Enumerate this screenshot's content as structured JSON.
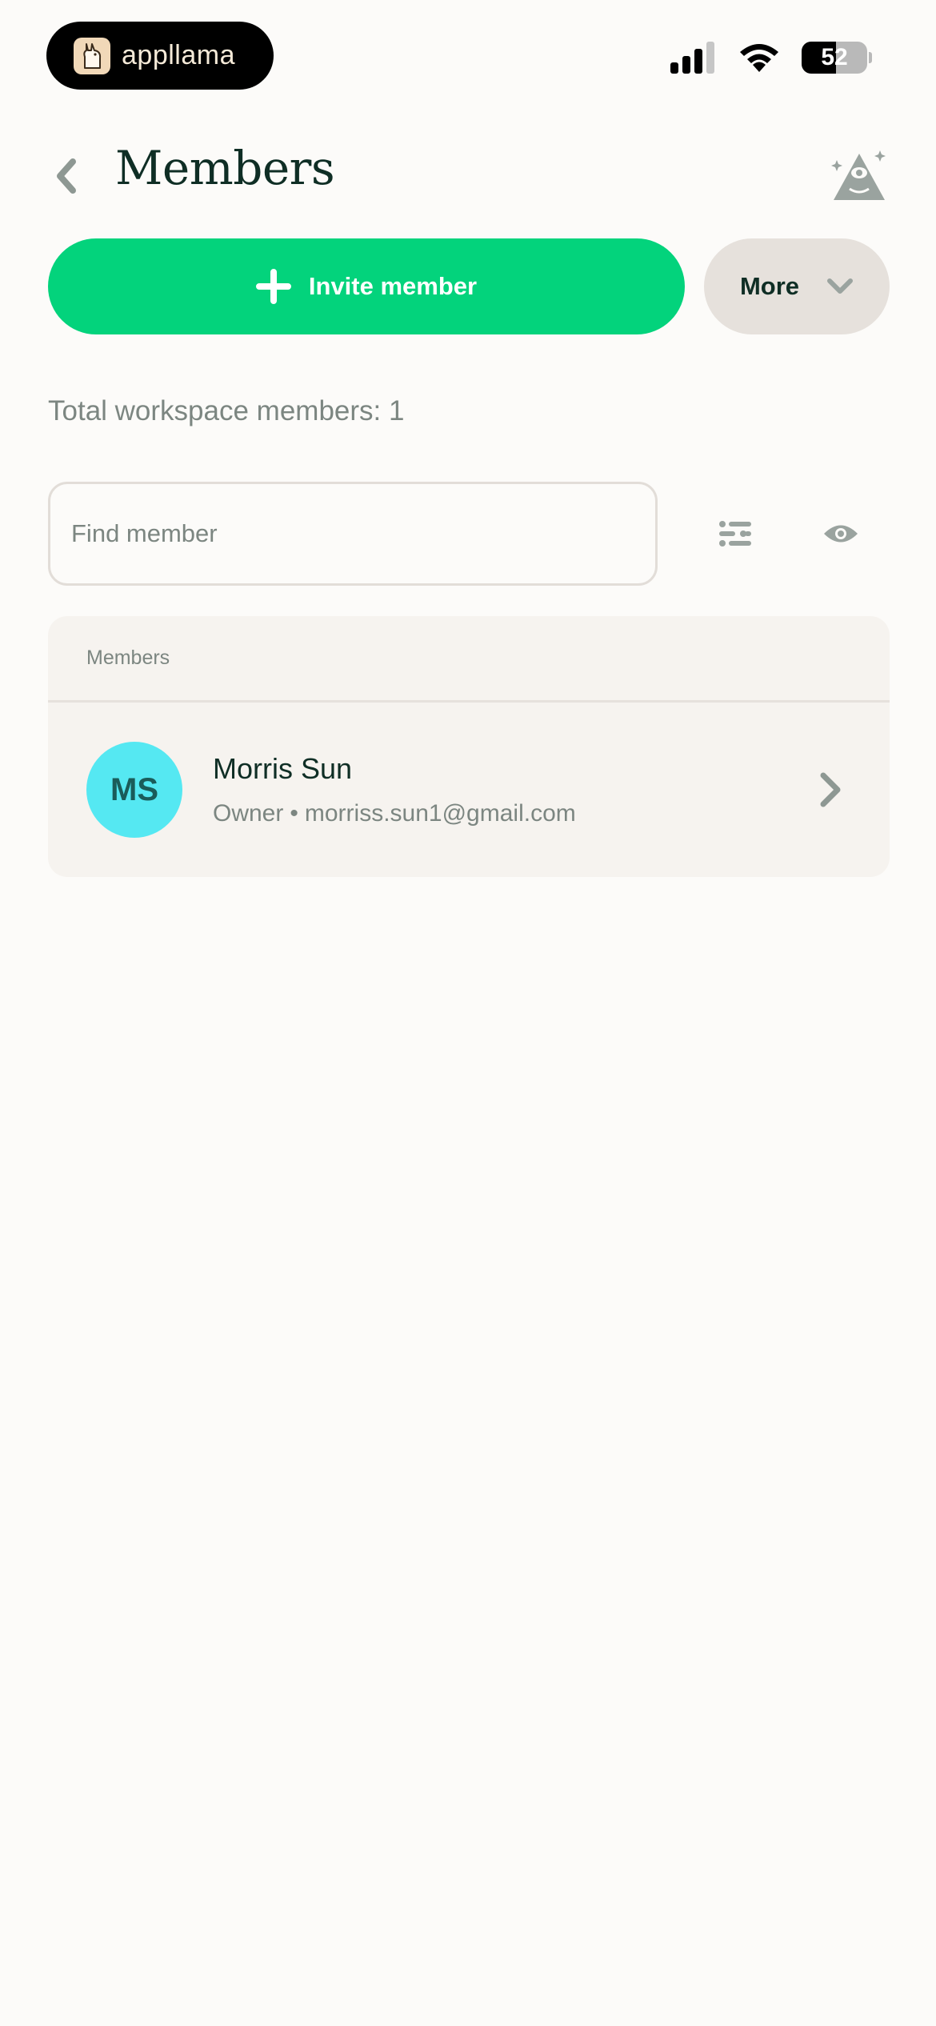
{
  "status_bar": {
    "brand_name": "appllama",
    "battery_level": "52",
    "battery_fraction": 0.52,
    "icons": [
      "signal-icon",
      "wifi-icon",
      "battery-icon"
    ]
  },
  "header": {
    "title": "Members",
    "back_icon": "chevron-left-icon",
    "wizard_icon": "wizard-icon"
  },
  "actions": {
    "invite_label": "Invite member",
    "more_label": "More"
  },
  "summary": {
    "total_text": "Total workspace members: 1"
  },
  "search": {
    "placeholder": "Find member",
    "value": ""
  },
  "members_list": {
    "header": "Members",
    "items": [
      {
        "initials": "MS",
        "name": "Morris Sun",
        "role": "Owner",
        "separator": "•",
        "email": "morriss.sun1@gmail.com"
      }
    ]
  },
  "colors": {
    "accent": "#03d37c",
    "background": "#fcfbf9",
    "text_primary": "#0f2e25",
    "text_secondary": "#7c8681",
    "avatar": "#55e8f2"
  }
}
